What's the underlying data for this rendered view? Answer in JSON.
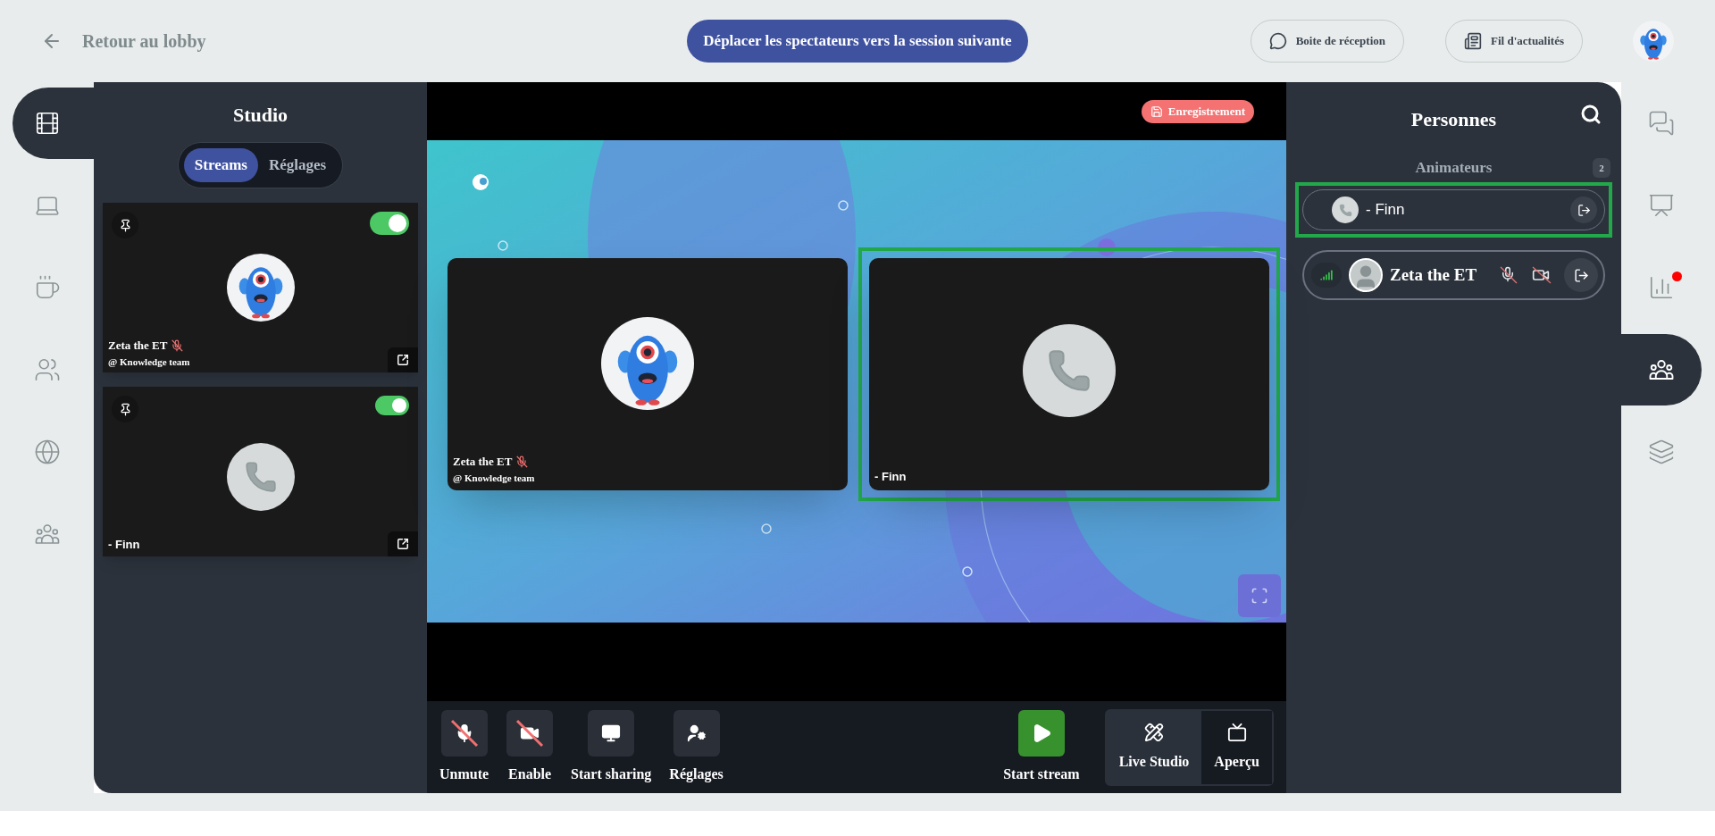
{
  "top_bar": {
    "back_label": "Retour au lobby",
    "primary_action": "Déplacer les spectateurs vers la session suivante",
    "buttons": [
      {
        "kind": "inbox",
        "label": "Boite de réception"
      },
      {
        "kind": "news",
        "label": "Fil d'actualités"
      }
    ]
  },
  "left_rail": [
    {
      "kind": "film",
      "selected": true
    },
    {
      "kind": "laptop",
      "selected": false
    },
    {
      "kind": "coffee",
      "selected": false
    },
    {
      "kind": "users",
      "selected": false
    },
    {
      "kind": "globe",
      "selected": false
    },
    {
      "kind": "group",
      "selected": false
    }
  ],
  "studio": {
    "title": "Studio",
    "tabs": [
      {
        "label": "Streams",
        "selected": true
      },
      {
        "label": "Réglages",
        "selected": false
      }
    ],
    "streams": [
      {
        "kind": "monster",
        "name": "Zeta the ET",
        "muted": true,
        "team": "@ Knowledge team",
        "on": true
      },
      {
        "kind": "phone",
        "name": "- Finn",
        "muted": false,
        "on": true
      }
    ]
  },
  "stage": {
    "recording_label": "Enregistrement",
    "tiles": [
      {
        "kind": "monster",
        "name": "Zeta the ET",
        "muted": true,
        "team": "@ Knowledge team",
        "highlighted": false
      },
      {
        "kind": "phone",
        "name": "- Finn",
        "muted": false,
        "highlighted": true
      }
    ]
  },
  "controls": [
    {
      "kind": "mic",
      "label": "Unmute",
      "off": true
    },
    {
      "kind": "camera",
      "label": "Enable",
      "off": true
    },
    {
      "kind": "screen",
      "label": "Start sharing",
      "off": false
    },
    {
      "kind": "settings",
      "label": "Réglages",
      "off": false
    }
  ],
  "stream_button": {
    "label": "Start stream"
  },
  "view_tabs": [
    {
      "kind": "studio",
      "label": "Live Studio",
      "selected": true
    },
    {
      "kind": "preview",
      "label": "Aperçu",
      "selected": false
    }
  ],
  "people": {
    "title": "Personnes",
    "section": "Animateurs",
    "count": "2",
    "members": [
      {
        "kind": "phone",
        "name": "- Finn",
        "highlighted": true
      },
      {
        "kind": "user",
        "name": "Zeta the ET",
        "highlighted": false,
        "muted": true,
        "camera_off": true
      }
    ]
  },
  "right_rail": [
    {
      "kind": "chat",
      "selected": false,
      "alert": false
    },
    {
      "kind": "presenter",
      "selected": false,
      "alert": false
    },
    {
      "kind": "poll",
      "selected": false,
      "alert": true
    },
    {
      "kind": "people",
      "selected": true,
      "alert": false
    },
    {
      "kind": "layers",
      "selected": false,
      "alert": false
    }
  ]
}
